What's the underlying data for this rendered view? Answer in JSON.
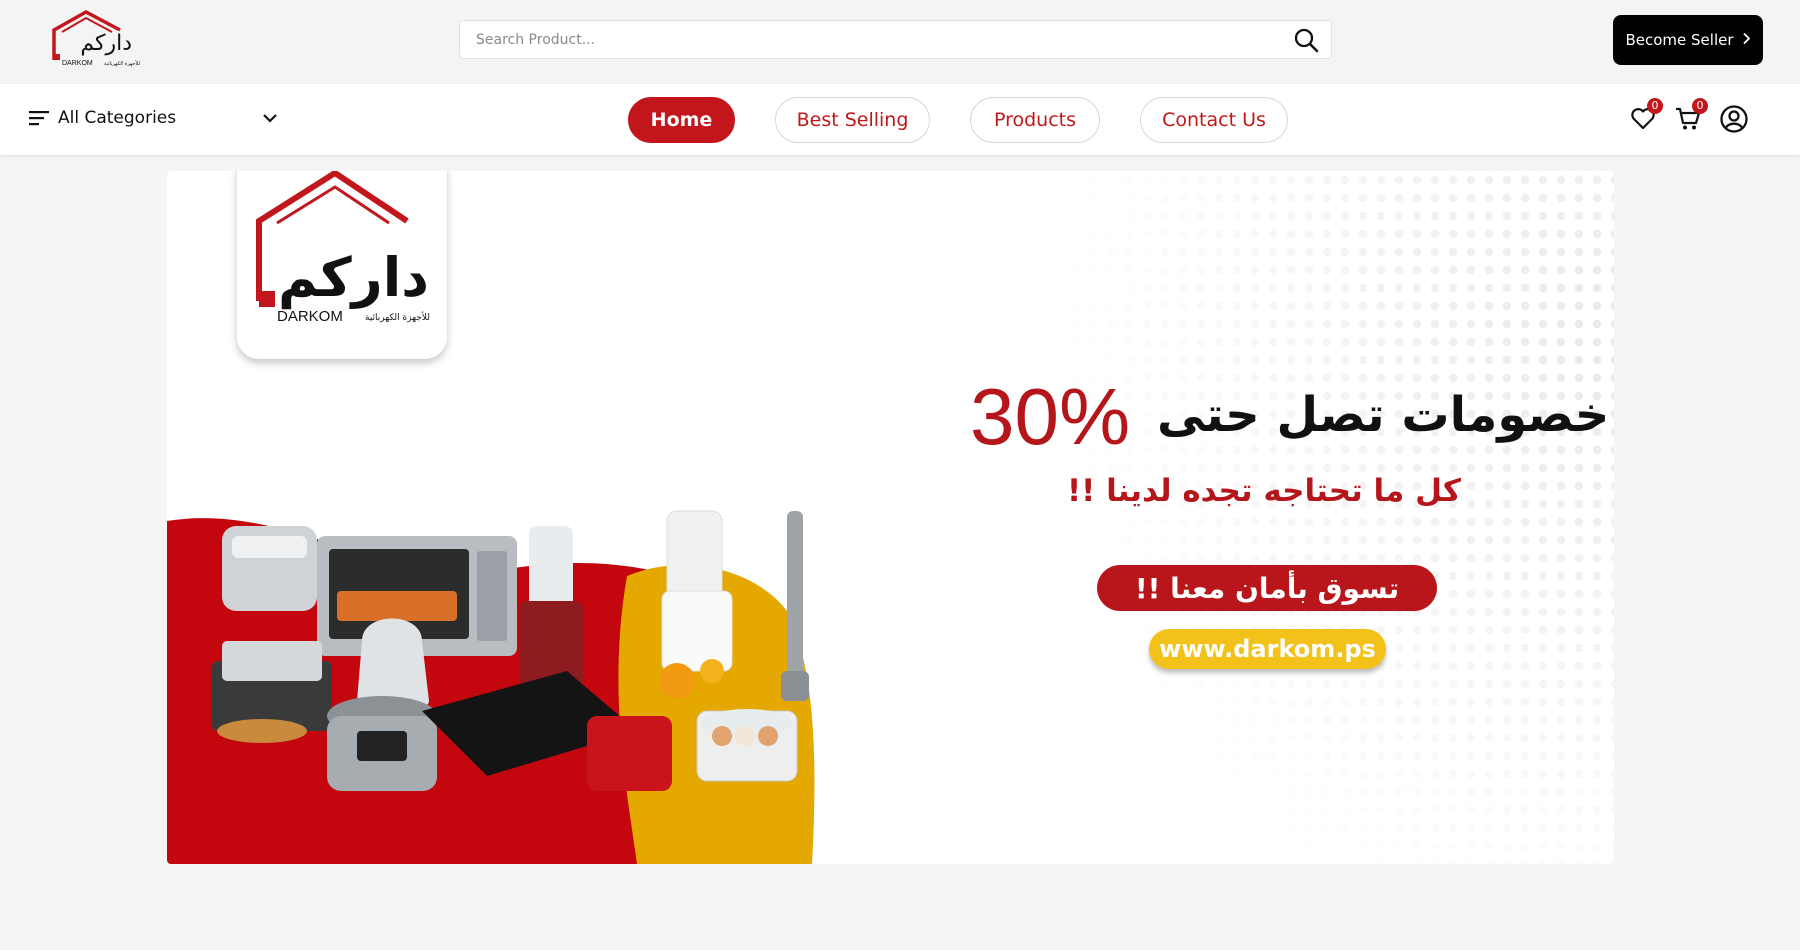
{
  "header": {
    "brand": {
      "arabic": "داركم",
      "latin": "DARKOM",
      "tagline": "للأجهزة الكهربائية"
    },
    "search": {
      "placeholder": "Search Product..."
    },
    "become_seller_label": "Become Seller",
    "become_seller_icon": "chevron-right-icon"
  },
  "nav": {
    "categories_label": "All Categories",
    "items": [
      {
        "label": "Home",
        "active": true
      },
      {
        "label": "Best Selling",
        "active": false
      },
      {
        "label": "Products",
        "active": false
      },
      {
        "label": "Contact Us",
        "active": false
      }
    ],
    "wishlist": {
      "icon": "heart-icon",
      "count": "0"
    },
    "cart": {
      "icon": "cart-icon",
      "count": "0"
    },
    "account": {
      "icon": "user-icon"
    }
  },
  "banner": {
    "logo": {
      "arabic": "داركم",
      "latin": "DARKOM",
      "tagline": "للأجهزة الكهربائية"
    },
    "discount_percent": "30%",
    "headline": "خصومات تصل حتى",
    "subline": "كل ما تحتاجه تجده لدينا !!",
    "cta": "تسوق بأمان معنا !!",
    "url": "www.darkom.ps"
  },
  "colors": {
    "brand_red": "#c3161c",
    "accent_yellow": "#f2c21a",
    "seller_button": "#000000"
  }
}
